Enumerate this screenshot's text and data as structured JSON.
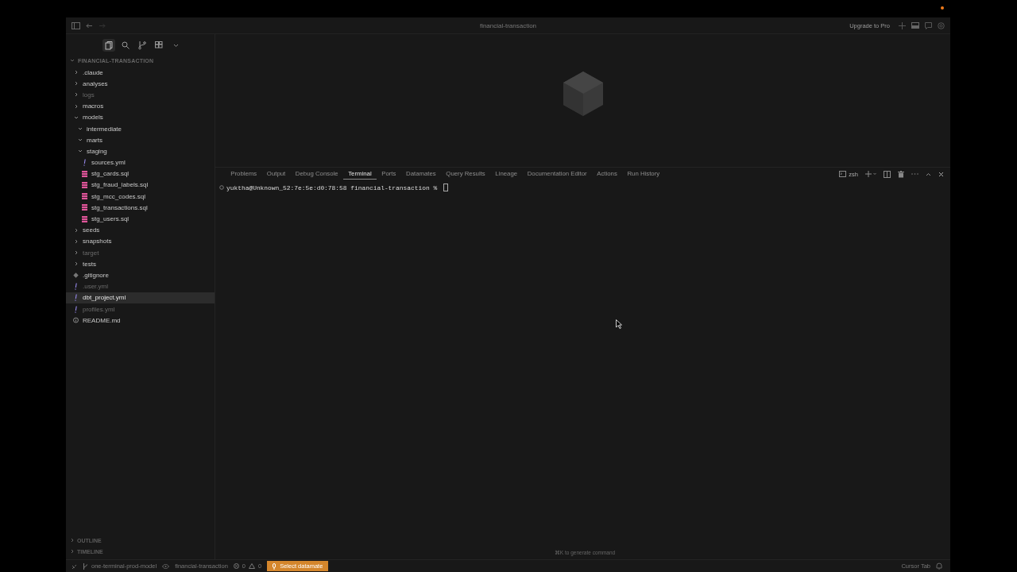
{
  "window": {
    "title": "financial-transaction",
    "upgrade": "Upgrade to Pro"
  },
  "sidebar": {
    "views": [
      {
        "kind": "files",
        "selected": true
      },
      {
        "kind": "search",
        "selected": false
      },
      {
        "kind": "branch",
        "selected": false
      },
      {
        "kind": "extensions",
        "selected": false
      }
    ],
    "header": "FINANCIAL-TRANSACTION",
    "tree": [
      {
        "label": ".claude",
        "kind": "folder",
        "expanded": false,
        "dimmed": false,
        "selected": false
      },
      {
        "label": "analyses",
        "kind": "folder",
        "expanded": false,
        "dimmed": false,
        "selected": false
      },
      {
        "label": "logs",
        "kind": "folder",
        "expanded": false,
        "dimmed": true,
        "selected": false
      },
      {
        "label": "macros",
        "kind": "folder",
        "expanded": false,
        "dimmed": false,
        "selected": false
      },
      {
        "label": "models",
        "kind": "folder",
        "expanded": true,
        "dimmed": false,
        "selected": false,
        "children": [
          {
            "label": "intermediate",
            "kind": "folder",
            "expanded": true,
            "dimmed": false,
            "selected": false
          },
          {
            "label": "marts",
            "kind": "folder",
            "expanded": true,
            "dimmed": false,
            "selected": false
          },
          {
            "label": "staging",
            "kind": "folder",
            "expanded": true,
            "dimmed": false,
            "selected": false,
            "children": [
              {
                "label": "sources.yml",
                "kind": "yml",
                "dimmed": false,
                "selected": false
              },
              {
                "label": "stg_cards.sql",
                "kind": "sql",
                "dimmed": false,
                "selected": false
              },
              {
                "label": "stg_fraud_labels.sql",
                "kind": "sql",
                "dimmed": false,
                "selected": false
              },
              {
                "label": "stg_mcc_codes.sql",
                "kind": "sql",
                "dimmed": false,
                "selected": false
              },
              {
                "label": "stg_transactions.sql",
                "kind": "sql",
                "dimmed": false,
                "selected": false
              },
              {
                "label": "stg_users.sql",
                "kind": "sql",
                "dimmed": false,
                "selected": false
              }
            ]
          }
        ]
      },
      {
        "label": "seeds",
        "kind": "folder",
        "expanded": false,
        "dimmed": false,
        "selected": false
      },
      {
        "label": "snapshots",
        "kind": "folder",
        "expanded": false,
        "dimmed": false,
        "selected": false
      },
      {
        "label": "target",
        "kind": "folder",
        "expanded": false,
        "dimmed": true,
        "selected": false
      },
      {
        "label": "tests",
        "kind": "folder",
        "expanded": false,
        "dimmed": false,
        "selected": false
      },
      {
        "label": ".gitignore",
        "kind": "git",
        "dimmed": false,
        "selected": false
      },
      {
        "label": ".user.yml",
        "kind": "yml",
        "dimmed": true,
        "selected": false
      },
      {
        "label": "dbt_project.yml",
        "kind": "yml",
        "dimmed": false,
        "selected": true
      },
      {
        "label": "profiles.yml",
        "kind": "yml",
        "dimmed": true,
        "selected": false
      },
      {
        "label": "README.md",
        "kind": "info",
        "dimmed": false,
        "selected": false
      }
    ],
    "sections": [
      {
        "label": "OUTLINE",
        "expanded": false
      },
      {
        "label": "TIMELINE",
        "expanded": false
      }
    ]
  },
  "panel": {
    "tabs": [
      {
        "label": "Problems",
        "selected": false
      },
      {
        "label": "Output",
        "selected": false
      },
      {
        "label": "Debug Console",
        "selected": false
      },
      {
        "label": "Terminal",
        "selected": true
      },
      {
        "label": "Ports",
        "selected": false
      },
      {
        "label": "Datamates",
        "selected": false
      },
      {
        "label": "Query Results",
        "selected": false
      },
      {
        "label": "Lineage",
        "selected": false
      },
      {
        "label": "Documentation Editor",
        "selected": false
      },
      {
        "label": "Actions",
        "selected": false
      },
      {
        "label": "Run History",
        "selected": false
      }
    ],
    "shell": "zsh",
    "prompt": "yuktha@Unknown_52:7e:5e:d0:78:58 financial-transaction % ",
    "hint": "⌘K to generate command"
  },
  "status_bar": {
    "branch": "one-terminal-prod-model",
    "project": "financial-transaction",
    "errors": "0",
    "warnings": "0",
    "datamate": "Select datamate",
    "cursor_tab": "Cursor Tab"
  }
}
